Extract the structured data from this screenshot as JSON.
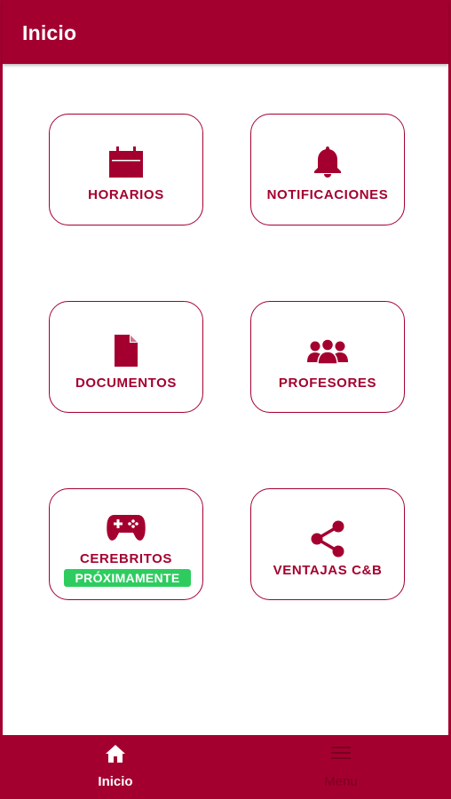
{
  "header": {
    "title": "Inicio"
  },
  "colors": {
    "brand": "#a4002f",
    "badge": "#2ecc5f",
    "text_on_brand": "#ffffff"
  },
  "cards": [
    {
      "label": "HORARIOS",
      "icon": "calendar-icon"
    },
    {
      "label": "NOTIFICACIONES",
      "icon": "bell-icon"
    },
    {
      "label": "DOCUMENTOS",
      "icon": "document-icon"
    },
    {
      "label": "PROFESORES",
      "icon": "group-icon"
    },
    {
      "label": "CEREBRITOS",
      "icon": "gamepad-icon",
      "badge": "PRÓXIMAMENTE"
    },
    {
      "label": "VENTAJAS C&B",
      "icon": "share-icon"
    }
  ],
  "bottom_nav": [
    {
      "label": "Inicio",
      "icon": "home-icon",
      "active": true
    },
    {
      "label": "Menu",
      "icon": "menu-icon",
      "active": false
    }
  ]
}
